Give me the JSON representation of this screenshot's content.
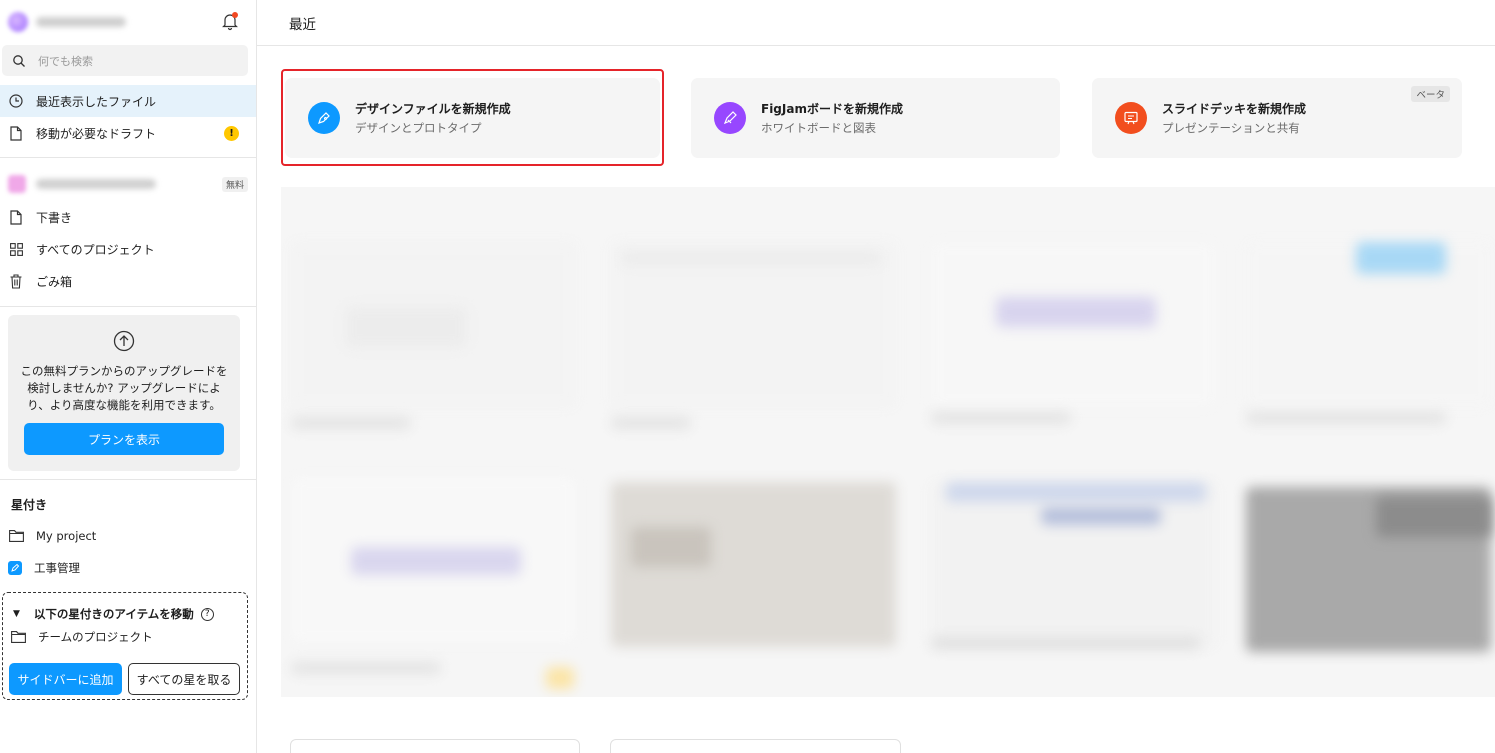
{
  "sidebar": {
    "search_placeholder": "何でも検索",
    "nav": [
      {
        "label": "最近表示したファイル",
        "icon": "clock-icon",
        "active": true
      },
      {
        "label": "移動が必要なドラフト",
        "icon": "file-icon",
        "badge": "!"
      }
    ],
    "team_badge": "無料",
    "team_nav": [
      {
        "label": "下書き",
        "icon": "file-icon"
      },
      {
        "label": "すべてのプロジェクト",
        "icon": "grid-icon"
      },
      {
        "label": "ごみ箱",
        "icon": "trash-icon"
      }
    ],
    "upgrade": {
      "text": "この無料プランからのアップグレードを検討しませんか? アップグレードにより、より高度な機能を利用できます。",
      "button": "プランを表示"
    },
    "starred": {
      "title": "星付き",
      "items": [
        {
          "label": "My project",
          "icon": "folder-icon"
        },
        {
          "label": "工事管理",
          "icon": "figma-design-icon"
        }
      ]
    },
    "move_starred": {
      "title": "以下の星付きのアイテムを移動",
      "help": "?",
      "item": "チームのプロジェクト",
      "add_button": "サイドバーに追加",
      "remove_button": "すべての星を取る"
    }
  },
  "main": {
    "title": "最近",
    "create_cards": [
      {
        "title": "デザインファイルを新規作成",
        "subtitle": "デザインとプロトタイプ",
        "icon": "design-pen-icon",
        "color": "#0d99ff"
      },
      {
        "title": "FigJamボードを新規作成",
        "subtitle": "ホワイトボードと図表",
        "icon": "figjam-marker-icon",
        "color": "#9747ff"
      },
      {
        "title": "スライドデッキを新規作成",
        "subtitle": "プレゼンテーションと共有",
        "icon": "slides-icon",
        "color": "#f24e1e",
        "badge": "ベータ"
      }
    ]
  },
  "colors": {
    "accent": "#0d99ff",
    "highlight": "#e5242a",
    "warning": "#ffc700"
  }
}
